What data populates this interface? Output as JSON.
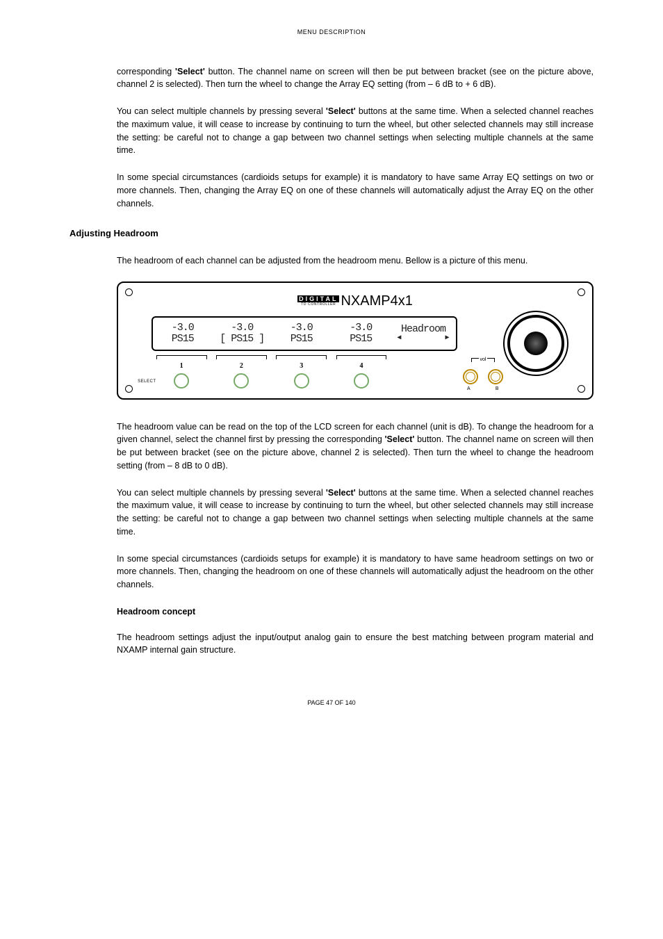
{
  "header": "MENU DESCRIPTION",
  "para1_a": "corresponding ",
  "para1_b": "'Select'",
  "para1_c": " button. The channel name on screen will then be put between bracket (see on the picture above, channel 2 is selected). Then turn the wheel to change the Array EQ setting (from – 6 dB to + 6 dB).",
  "para2_a": "You can select multiple channels by pressing several ",
  "para2_b": "'Select'",
  "para2_c": " buttons at the same time. When a selected channel reaches the maximum value, it will cease to increase by continuing to turn the wheel, but other selected channels may still increase the setting: be careful not to change a gap between two channel settings when selecting multiple channels at the same time.",
  "para3": "In some special circumstances (cardioids setups for example) it is mandatory to have same Array EQ settings on two or more channels. Then, changing the Array EQ on one of these channels will automatically adjust the Array EQ on the other channels.",
  "heading1": "Adjusting Headroom",
  "para4": "The headroom of each channel can be adjusted from the headroom menu. Bellow is a picture of this menu.",
  "device": {
    "logo_top": "DIGITAL",
    "logo_sub": "TD CONTROLLER",
    "product": "NXAMP4x1",
    "lcd": {
      "ch1_top": "-3.0",
      "ch1_bot": "PS15",
      "ch2_top": "-3.0",
      "ch2_bot": "[ PS15 ]",
      "ch3_top": "-3.0",
      "ch3_bot": "PS15",
      "ch4_top": "-3.0",
      "ch4_bot": "PS15",
      "menu": "Headroom",
      "arrow_l": "◀",
      "arrow_r": "▶"
    },
    "nums": {
      "n1": "1",
      "n2": "2",
      "n3": "3",
      "n4": "4"
    },
    "select_label": "SELECT",
    "vol_label": "vol",
    "vol_a": "A",
    "vol_b": "B"
  },
  "para5_a": "The headroom value can be read on the top of the LCD screen for each channel (unit is dB). To change the headroom for a given channel, select the channel first by pressing the corresponding ",
  "para5_b": "'Select'",
  "para5_c": " button. The channel name on screen will then be put between bracket (see on the picture above, channel 2 is selected). Then turn the wheel to change the headroom setting (from – 8 dB to 0 dB).",
  "para6_a": "You can select multiple channels by pressing several ",
  "para6_b": "'Select'",
  "para6_c": " buttons at the same time. When a selected channel reaches the maximum value, it will cease to increase by continuing to turn the wheel, but other selected channels may still increase the setting: be careful not to change a gap between two channel settings when selecting multiple channels at the same time.",
  "para7": "In some special circumstances (cardioids setups for example) it is mandatory to have same headroom settings on two or more channels. Then, changing the headroom on one of these channels will automatically adjust the headroom on the other channels.",
  "sub_heading": "Headroom concept",
  "para8": "The headroom settings adjust the input/output analog gain to ensure the best matching between program material and NXAMP internal gain structure.",
  "footer": "PAGE 47 OF 140"
}
